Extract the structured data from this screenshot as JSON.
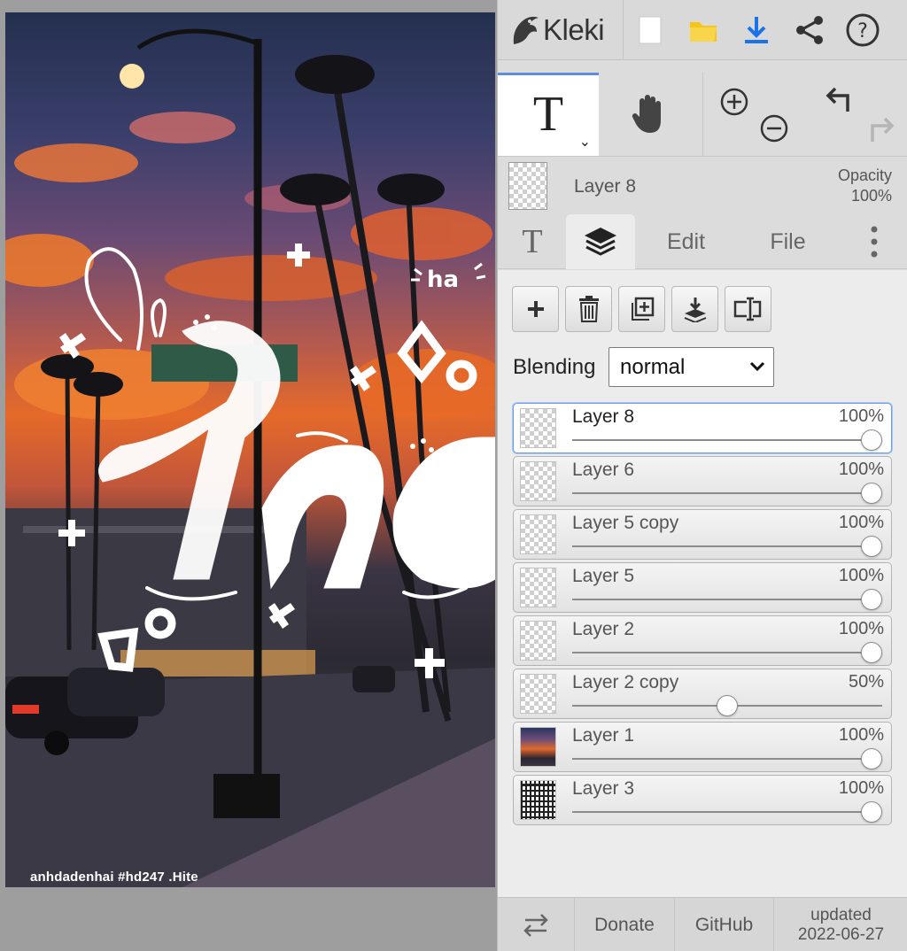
{
  "canvas": {
    "watermark": "anhdadenhai #hd247 .Hite"
  },
  "app": {
    "logo_text": "Kleki"
  },
  "tool": {
    "text_glyph": "T",
    "caret": "⌄"
  },
  "current_layer": {
    "name": "Layer 8",
    "opacity_label": "Opacity",
    "opacity_value": "100%"
  },
  "tabs": {
    "text_tab_glyph": "T",
    "edit": "Edit",
    "file": "File"
  },
  "blending": {
    "label": "Blending",
    "value": "normal"
  },
  "layers": [
    {
      "name": "Layer 8",
      "opacity": "100%",
      "value": 1.0,
      "selected": true,
      "thumb": "empty"
    },
    {
      "name": "Layer 6",
      "opacity": "100%",
      "value": 1.0,
      "selected": false,
      "thumb": "empty"
    },
    {
      "name": "Layer 5 copy",
      "opacity": "100%",
      "value": 1.0,
      "selected": false,
      "thumb": "empty"
    },
    {
      "name": "Layer 5",
      "opacity": "100%",
      "value": 1.0,
      "selected": false,
      "thumb": "empty"
    },
    {
      "name": "Layer 2",
      "opacity": "100%",
      "value": 1.0,
      "selected": false,
      "thumb": "empty"
    },
    {
      "name": "Layer 2 copy",
      "opacity": "50%",
      "value": 0.5,
      "selected": false,
      "thumb": "empty"
    },
    {
      "name": "Layer 1",
      "opacity": "100%",
      "value": 1.0,
      "selected": false,
      "thumb": "photo"
    },
    {
      "name": "Layer 3",
      "opacity": "100%",
      "value": 1.0,
      "selected": false,
      "thumb": "pattern"
    }
  ],
  "footer": {
    "donate": "Donate",
    "github": "GitHub",
    "updated_label": "updated",
    "updated_date": "2022-06-27"
  },
  "colors": {
    "accent": "#5a8fe0",
    "download_icon": "#1a73e8",
    "folder_icon": "#f5c518"
  }
}
